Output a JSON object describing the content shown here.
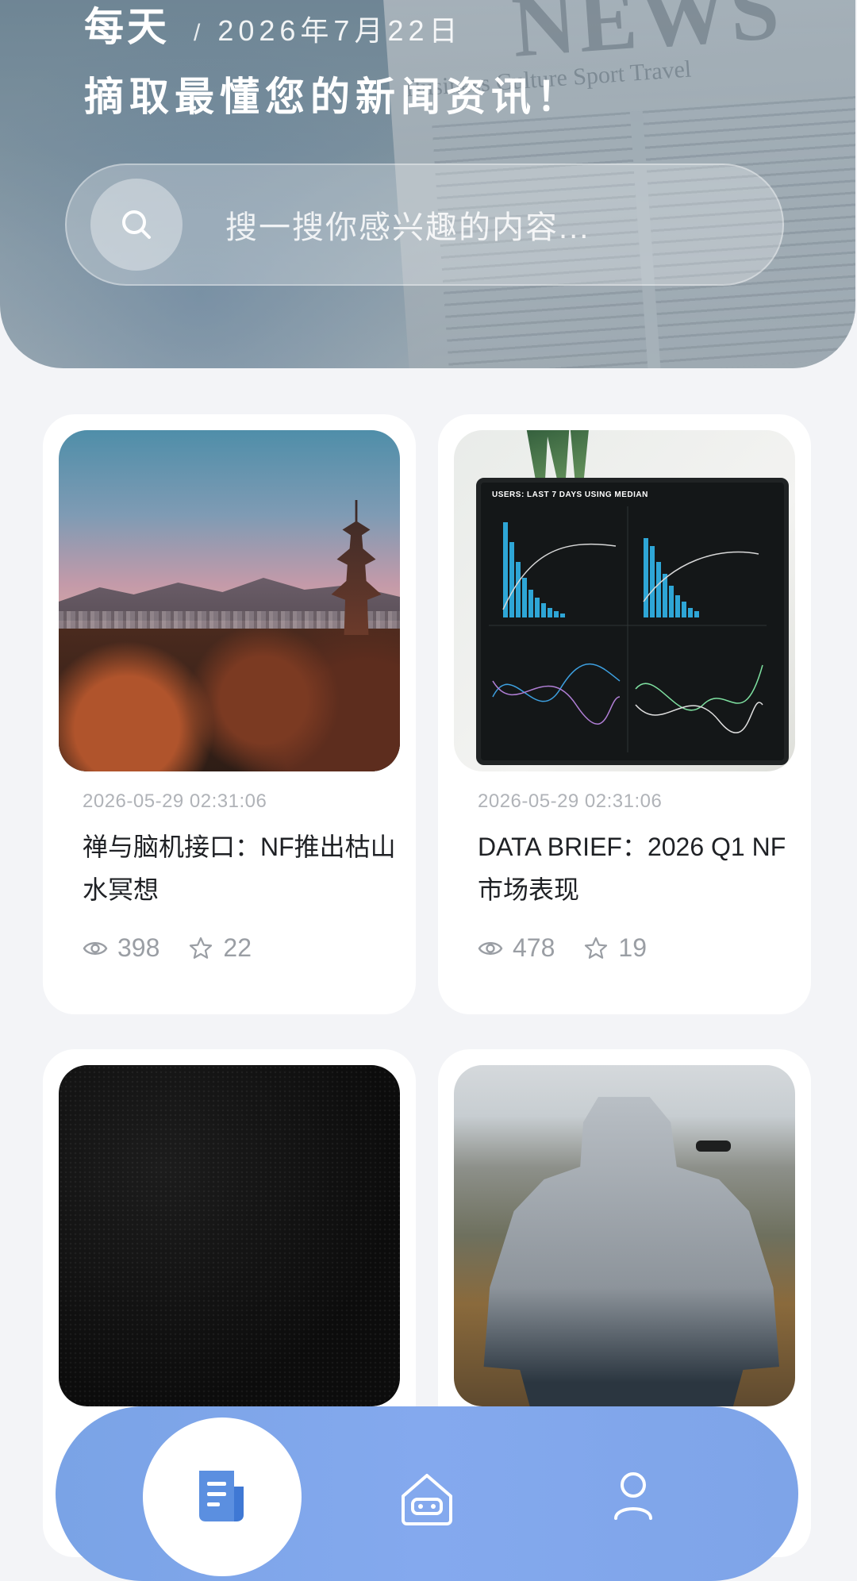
{
  "header": {
    "title_main": "每天",
    "title_separator": "/",
    "date": "2026年7月22日",
    "subtitle": "摘取最懂您的新闻资讯！",
    "background_headline": "NEWS",
    "background_sections": "Business Culture Sport Travel"
  },
  "search": {
    "icon": "search-icon",
    "placeholder": "搜一搜你感兴趣的内容..."
  },
  "articles": [
    {
      "time": "2026-05-29 02:31:06",
      "title": "禅与脑机接口：NF推出枯山水冥想",
      "views": "398",
      "stars": "22",
      "image": "kyoto-pagoda-sunset"
    },
    {
      "time": "2026-05-29 02:31:06",
      "title": "DATA BRIEF：2026 Q1 NF市场表现",
      "views": "478",
      "stars": "19",
      "image": "analytics-dashboard-tablet",
      "image_caption": "USERS: LAST 7 DAYS USING MEDIAN"
    },
    {
      "image": "black-texture"
    },
    {
      "image": "hooded-person-drone"
    }
  ],
  "bottom_nav": {
    "items": [
      {
        "icon": "news-icon",
        "active": true
      },
      {
        "icon": "robot-home-icon",
        "active": false
      },
      {
        "icon": "user-icon",
        "active": false
      }
    ],
    "colors": {
      "bar": "#7fa5ea",
      "active_icon": "#5b8fe0",
      "inactive_icon": "#ffffff"
    }
  },
  "colors": {
    "background": "#f3f4f7",
    "card": "#ffffff",
    "muted_text": "#b0b3b8"
  }
}
